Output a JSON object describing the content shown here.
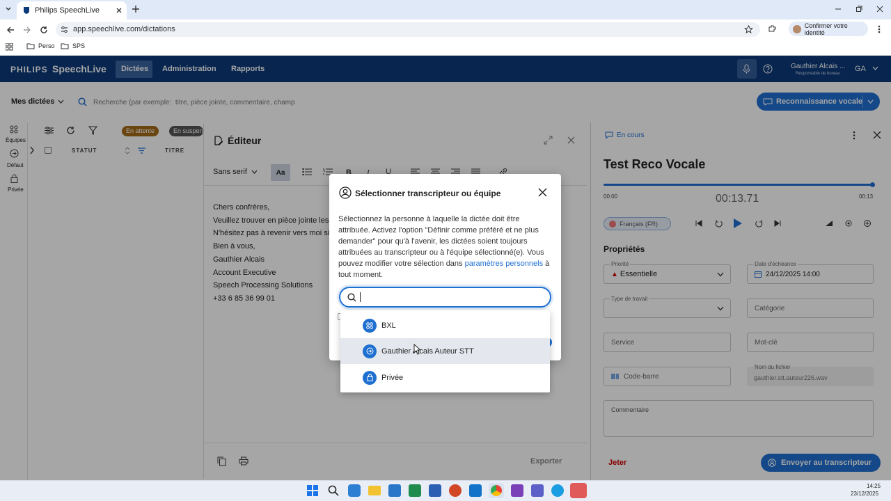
{
  "browser": {
    "tab_title": "Philips SpeechLive",
    "url": "app.speechlive.com/dictations",
    "profile_label": "Confirmer votre identité",
    "bookmarks": [
      "Perso",
      "SPS"
    ]
  },
  "header": {
    "brand": "PHILIPS",
    "product": "SpeechLive",
    "nav": [
      "Dictées",
      "Administration",
      "Rapports"
    ],
    "user_name": "Gauthier Alcais ...",
    "user_role": "Responsable de bureau",
    "user_initials": "GA"
  },
  "subbar": {
    "view_label": "Mes dictées",
    "search_placeholder": "Recherche (par exemple:  titre, pièce jointe, commentaire, champ",
    "voice_button": "Reconnaissance vocale"
  },
  "rail": {
    "items": [
      "Équipes",
      "Défaut",
      "Privée"
    ]
  },
  "list": {
    "chips": [
      "En attente",
      "En suspens"
    ],
    "col_status": "STATUT",
    "col_title": "TITRE"
  },
  "editor": {
    "title": "Éditeur",
    "font": "Sans serif",
    "lines": [
      "Chers confrères,",
      "Veuillez trouver en pièce jointe les",
      "N'hésitez pas à revenir vers moi si v",
      "Bien à vous,",
      "Gauthier Alcais",
      "Account Executive",
      "Speech Processing Solutions",
      "+33 6 85 36 99 01"
    ],
    "export_label": "Exporter"
  },
  "detail": {
    "status": "En cours",
    "title": "Test Reco Vocale",
    "time_start": "00:00",
    "time_current": "00:13.71",
    "time_end": "00:13",
    "language": "Français (FR)",
    "properties_title": "Propriétés",
    "priority_label": "Priorité",
    "priority_value": "Essentielle",
    "due_label": "Date d'échéance",
    "due_value": "24/12/2025 14:00",
    "worktype_label": "Type de travail",
    "category_placeholder": "Catégorie",
    "service_placeholder": "Service",
    "keyword_placeholder": "Mot-clé",
    "barcode_placeholder": "Code-barre",
    "filename_label": "Nom du fichier",
    "filename_value": "gauthier.stt.auteur226.wav",
    "comment_label": "Commentaire",
    "discard_label": "Jeter",
    "send_label": "Envoyer au transcripteur"
  },
  "dialog": {
    "title": "Sélectionner transcripteur ou équipe",
    "body_before": "Sélectionnez la personne à laquelle la dictée doit être attribuée. Activez l'option \"Définir comme préféré et ne plus demander\" pour qu'à l'avenir, les dictées soient toujours attribuées au transcripteur ou à l'équipe sélectionné(e). Vous pouvez modifier votre sélection dans ",
    "body_link": "paramètres personnels",
    "body_after": " à tout moment.",
    "options": [
      "BXL",
      "Gauthier Alcais Auteur STT",
      "Privée"
    ]
  },
  "taskbar": {
    "time": "14:25",
    "date": "23/12/2025"
  },
  "colors": {
    "brand_blue": "#0b3a7a",
    "accent": "#1f6fd1",
    "chip": "#a46a1a"
  }
}
